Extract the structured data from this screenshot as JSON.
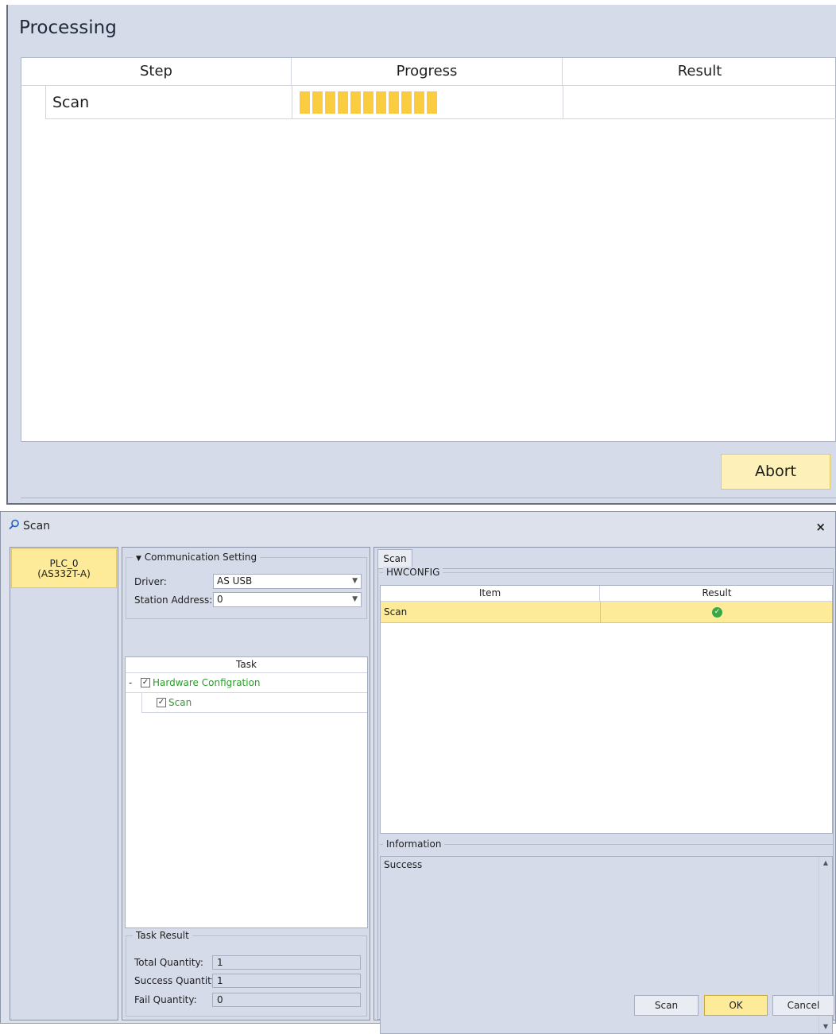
{
  "processing": {
    "title": "Processing",
    "columns": [
      "Step",
      "Progress",
      "Result"
    ],
    "rows": [
      {
        "step": "Scan",
        "progress_segments": 11,
        "result": ""
      }
    ],
    "abort_label": "Abort",
    "progress_color": "#fbcb40"
  },
  "scan_dialog": {
    "title": "Scan",
    "close_glyph": "×",
    "plc": {
      "name": "PLC_0",
      "model": "(AS332T-A)"
    },
    "comm": {
      "group_title": "Communication Setting",
      "driver_label": "Driver:",
      "driver_value": "AS USB",
      "station_label": "Station Address:",
      "station_value": "0"
    },
    "task": {
      "header": "Task",
      "collapse_glyph": "-",
      "items": [
        "Hardware Configration",
        "Scan"
      ]
    },
    "task_result": {
      "group_title": "Task Result",
      "total_label": "Total Quantity:",
      "total_value": "1",
      "success_label": "Success Quantity:",
      "success_value": "1",
      "fail_label": "Fail Quantity:",
      "fail_value": "0"
    },
    "right": {
      "tab_label": "Scan",
      "hw_group_title": "HWCONFIG",
      "columns": [
        "Item",
        "Result"
      ],
      "rows": [
        {
          "item": "Scan",
          "result_icon": "success-check-icon"
        }
      ],
      "info_title": "Information",
      "info_text": "Success"
    },
    "buttons": {
      "scan": "Scan",
      "ok": "OK",
      "cancel": "Cancel"
    },
    "accent_color": "#fdeb99"
  }
}
